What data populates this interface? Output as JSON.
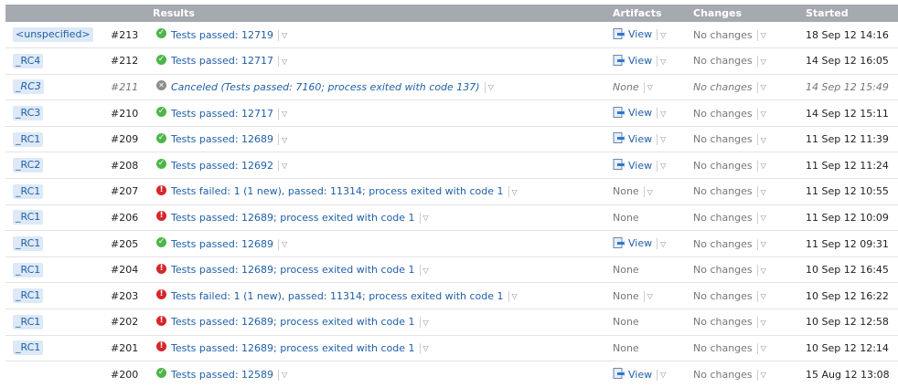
{
  "header": {
    "branch": "",
    "number": "",
    "results": "Results",
    "artifacts": "Artifacts",
    "changes": "Changes",
    "started": "Started"
  },
  "rows": [
    {
      "branch": "<unspecified>",
      "number": "#213",
      "status": "success",
      "result": "Tests passed: 12719",
      "artifacts": "View",
      "changes": "No changes",
      "started": "18 Sep 12 14:16"
    },
    {
      "branch": "_RC4",
      "number": "#212",
      "status": "success",
      "result": "Tests passed: 12717",
      "artifacts": "View",
      "changes": "No changes",
      "started": "14 Sep 12 16:05"
    },
    {
      "branch": "_RC3",
      "number": "#211",
      "status": "canceled",
      "result": "Canceled (Tests passed: 7160; process exited with code 137)",
      "artifacts": "None",
      "changes": "No changes",
      "started": "14 Sep 12 15:49"
    },
    {
      "branch": "_RC3",
      "number": "#210",
      "status": "success",
      "result": "Tests passed: 12717",
      "artifacts": "View",
      "changes": "No changes",
      "started": "14 Sep 12 15:11"
    },
    {
      "branch": "_RC1",
      "number": "#209",
      "status": "success",
      "result": "Tests passed: 12689",
      "artifacts": "View",
      "changes": "No changes",
      "started": "11 Sep 12 11:39"
    },
    {
      "branch": "_RC2",
      "number": "#208",
      "status": "success",
      "result": "Tests passed: 12692",
      "artifacts": "View",
      "changes": "No changes",
      "started": "11 Sep 12 11:24"
    },
    {
      "branch": "_RC1",
      "number": "#207",
      "status": "failed",
      "result": "Tests failed: 1 (1 new), passed: 11314; process exited with code 1",
      "artifacts": "None",
      "changes": "No changes",
      "started": "11 Sep 12 10:55"
    },
    {
      "branch": "_RC1",
      "number": "#206",
      "status": "failed",
      "result": "Tests passed: 12689; process exited with code 1",
      "artifacts": "None",
      "changes": "No changes",
      "started": "11 Sep 12 10:09"
    },
    {
      "branch": "_RC1",
      "number": "#205",
      "status": "success",
      "result": "Tests passed: 12689",
      "artifacts": "View",
      "changes": "No changes",
      "started": "11 Sep 12 09:31"
    },
    {
      "branch": "_RC1",
      "number": "#204",
      "status": "failed",
      "result": "Tests passed: 12689; process exited with code 1",
      "artifacts": "None",
      "changes": "No changes",
      "started": "10 Sep 12 16:45"
    },
    {
      "branch": "_RC1",
      "number": "#203",
      "status": "failed",
      "result": "Tests failed: 1 (1 new), passed: 11314; process exited with code 1",
      "artifacts": "None",
      "changes": "No changes",
      "started": "10 Sep 12 16:22"
    },
    {
      "branch": "_RC1",
      "number": "#202",
      "status": "failed",
      "result": "Tests passed: 12689; process exited with code 1",
      "artifacts": "None",
      "changes": "No changes",
      "started": "10 Sep 12 12:58"
    },
    {
      "branch": "_RC1",
      "number": "#201",
      "status": "failed",
      "result": "Tests passed: 12689; process exited with code 1",
      "artifacts": "None",
      "changes": "No changes",
      "started": "10 Sep 12 12:14"
    },
    {
      "branch": "",
      "number": "#200",
      "status": "success",
      "result": "Tests passed: 12589",
      "artifacts": "View",
      "changes": "No changes",
      "started": "15 Aug 12 13:08"
    }
  ],
  "icons": {
    "success": "check-circle-icon",
    "failed": "error-circle-icon",
    "canceled": "cancel-circle-icon",
    "artifact": "artifact-download-icon",
    "dropdown": "chevron-down-icon"
  },
  "colors": {
    "header_bg": "#a5a9b0",
    "link": "#1f5fa8",
    "success": "#4cb648",
    "failed": "#d6262b",
    "canceled": "#8c8c8c",
    "branch_tag_bg": "#dde9f6"
  }
}
